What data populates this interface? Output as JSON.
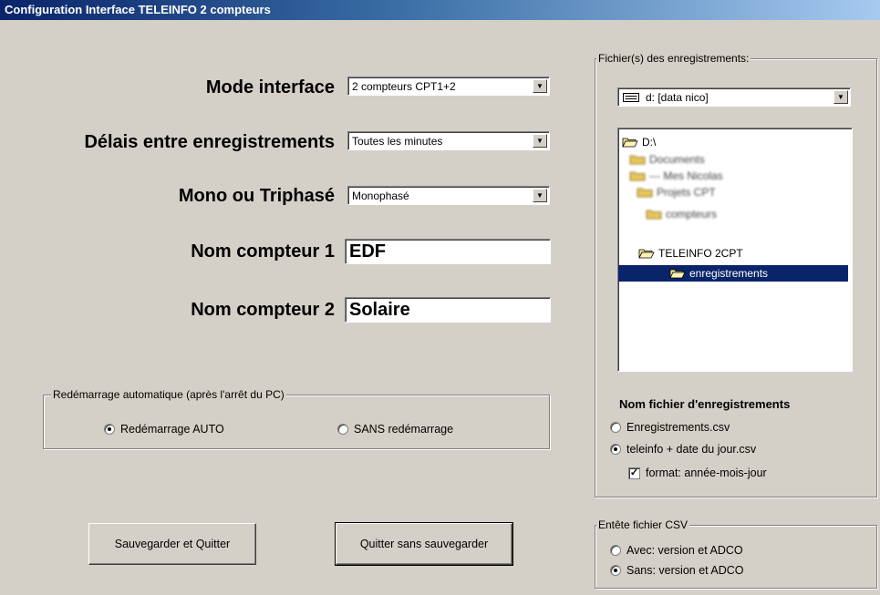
{
  "window": {
    "title": "Configuration Interface TELEINFO 2 compteurs"
  },
  "form": {
    "mode_label": "Mode interface",
    "mode_value": "2 compteurs CPT1+2",
    "delay_label": "Délais  entre enregistrements",
    "delay_value": "Toutes les minutes",
    "phase_label": "Mono ou Triphasé",
    "phase_value": "Monophasé",
    "name1_label": "Nom compteur 1",
    "name1_value": "EDF",
    "name2_label": "Nom compteur 2",
    "name2_value": "Solaire"
  },
  "restart": {
    "legend": "Redémarrage automatique (après l'arrêt du PC)",
    "auto_label": "Redémarrage AUTO",
    "none_label": "SANS redémarrage",
    "selected": "auto"
  },
  "buttons": {
    "save_quit": "Sauvegarder et Quitter",
    "quit_nosave": "Quitter sans sauvegarder"
  },
  "files": {
    "legend": "Fichier(s) des enregistrements:",
    "drive": "d: [data nico]",
    "tree": [
      {
        "label": "D:\\",
        "level": 0,
        "state": "open"
      },
      {
        "label": "Documents",
        "level": 0,
        "state": "blurred"
      },
      {
        "label": "--- Mes Nicolas",
        "level": 0,
        "state": "blurred"
      },
      {
        "label": "Projets CPT",
        "level": 1,
        "state": "blurred"
      },
      {
        "label": "compteurs",
        "level": 1,
        "state": "blurred"
      },
      {
        "label": "TELEINFO 2CPT",
        "level": 1,
        "state": "open"
      },
      {
        "label": "enregistrements",
        "level": 2,
        "state": "selected"
      }
    ],
    "name_title": "Nom fichier d'enregistrements",
    "opt1": "Enregistrements.csv",
    "opt2": "teleinfo + date du jour.csv",
    "format_label": "format: année-mois-jour",
    "selected": "opt2",
    "format_checked": true
  },
  "csv": {
    "legend": "Entête fichier CSV",
    "opt_with": "Avec: version et ADCO",
    "opt_without": "Sans: version et ADCO",
    "selected": "without"
  },
  "colors": {
    "window_bg": "#d4d0c8",
    "title_start": "#0a246a",
    "title_end": "#a6caf0",
    "selection": "#0a246a"
  }
}
